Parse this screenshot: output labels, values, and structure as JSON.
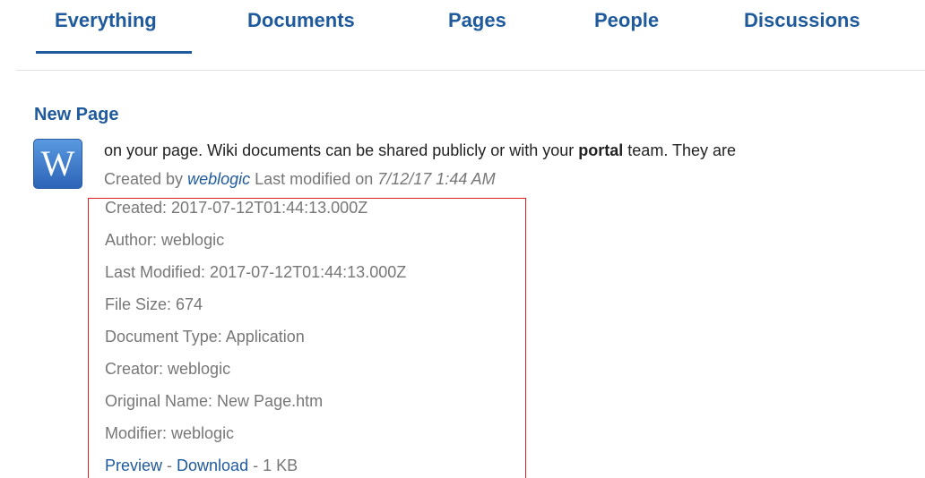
{
  "tabs": [
    {
      "label": "Everything",
      "active": true
    },
    {
      "label": "Documents",
      "active": false
    },
    {
      "label": "Pages",
      "active": false
    },
    {
      "label": "People",
      "active": false
    },
    {
      "label": "Discussions",
      "active": false
    }
  ],
  "result": {
    "title": "New Page",
    "icon_letter": "W",
    "icon": "word-document-icon",
    "snippet": {
      "before": "on your page. Wiki documents can be shared publicly or with your ",
      "highlight": "portal",
      "after": " team. They are"
    },
    "meta": {
      "created_by_label": "Created by",
      "author": "weblogic",
      "modified_label": "Last modified on",
      "modified_date": "7/12/17 1:44 AM"
    },
    "properties": [
      "Created: 2017-07-12T01:44:13.000Z",
      "Author: weblogic",
      "Last Modified: 2017-07-12T01:44:13.000Z",
      "File Size: 674",
      "Document Type: Application",
      "Creator: weblogic",
      "Original Name: New Page.htm",
      "Modifier: weblogic"
    ],
    "links": {
      "preview": "Preview",
      "separator": " - ",
      "download": "Download",
      "size": "1 KB"
    }
  },
  "colors": {
    "accent": "#1f5a9c",
    "highlight_border": "#e02020",
    "meta_text": "#777777"
  }
}
